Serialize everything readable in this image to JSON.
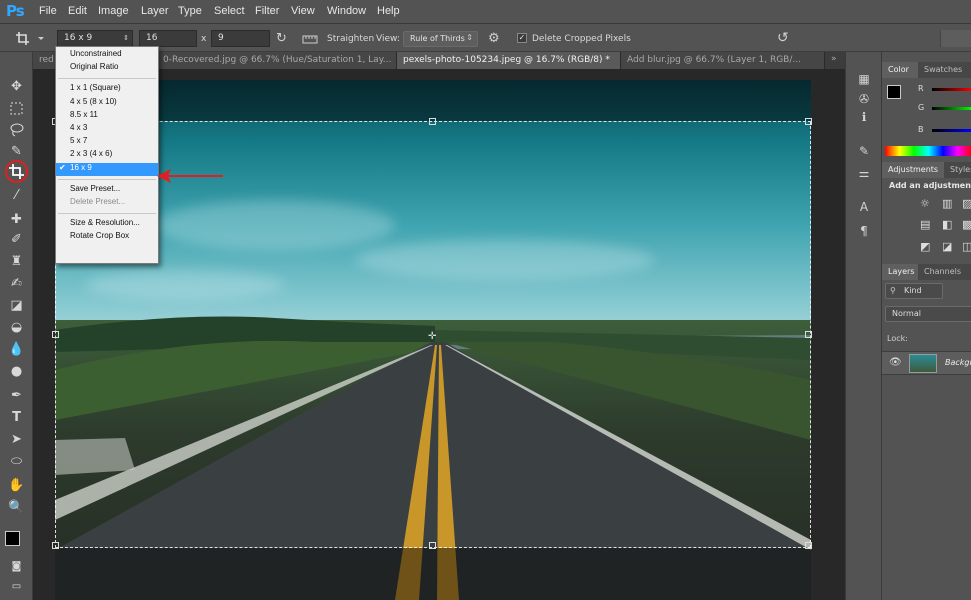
{
  "app": {
    "logo": "Ps"
  },
  "menu": [
    "File",
    "Edit",
    "Image",
    "Layer",
    "Type",
    "Select",
    "Filter",
    "View",
    "Window",
    "Help"
  ],
  "options": {
    "preset_value": "16 x 9",
    "width_value": "16",
    "swap_symbol": "x",
    "height_value": "9",
    "straighten_label": "Straighten",
    "view_label": "View:",
    "view_value": "Rule of Thirds",
    "delete_cropped_label": "Delete Cropped Pixels",
    "delete_cropped_checked": true
  },
  "tabs": [
    {
      "label": "red",
      "active": false
    },
    {
      "label": "0-Recovered.jpg @ 66.7% (Hue/Saturation 1, Lay...",
      "active": false
    },
    {
      "label": "pexels-photo-105234.jpeg @ 16.7% (RGB/8) *",
      "active": true
    },
    {
      "label": "Add blur.jpg @ 66.7% (Layer 1, RGB/...",
      "active": false
    }
  ],
  "tools": [
    "move-tool",
    "marquee-tool",
    "lasso-tool",
    "quick-selection-tool",
    "crop-tool",
    "eyedropper-tool",
    "spot-healing-tool",
    "brush-tool",
    "clone-stamp-tool",
    "history-brush-tool",
    "eraser-tool",
    "paint-bucket-tool",
    "blur-tool",
    "dodge-tool",
    "pen-tool",
    "type-tool",
    "path-selection-tool",
    "ellipse-tool",
    "hand-tool",
    "zoom-tool"
  ],
  "dropdown": {
    "groups": [
      [
        "Unconstrained",
        "Original Ratio"
      ],
      [
        "1 x 1 (Square)",
        "4 x 5 (8 x 10)",
        "8.5 x 11",
        "4 x 3",
        "5 x 7",
        "2 x 3 (4 x 6)",
        "16 x 9"
      ],
      [
        "Save Preset...",
        "Delete Preset..."
      ],
      [
        "Size & Resolution...",
        "Rotate Crop Box"
      ]
    ],
    "selected": "16 x 9",
    "disabled": [
      "Delete Preset..."
    ],
    "check_mark": "✔"
  },
  "panels": {
    "color_tab": "Color",
    "swatches_tab": "Swatches",
    "channels": [
      "R",
      "G",
      "B"
    ],
    "adjustments_tab": "Adjustments",
    "styles_tab": "Styles",
    "add_adjustment": "Add an adjustment",
    "layers_tab": "Layers",
    "channels_tab": "Channels",
    "kind_label": "Kind",
    "blend_mode": "Normal",
    "lock_label": "Lock:",
    "layer_name": "Backgr"
  },
  "colors": {
    "annotation_red": "#e02020",
    "selection_blue": "#3399ff",
    "ps_blue": "#31a8ff"
  }
}
